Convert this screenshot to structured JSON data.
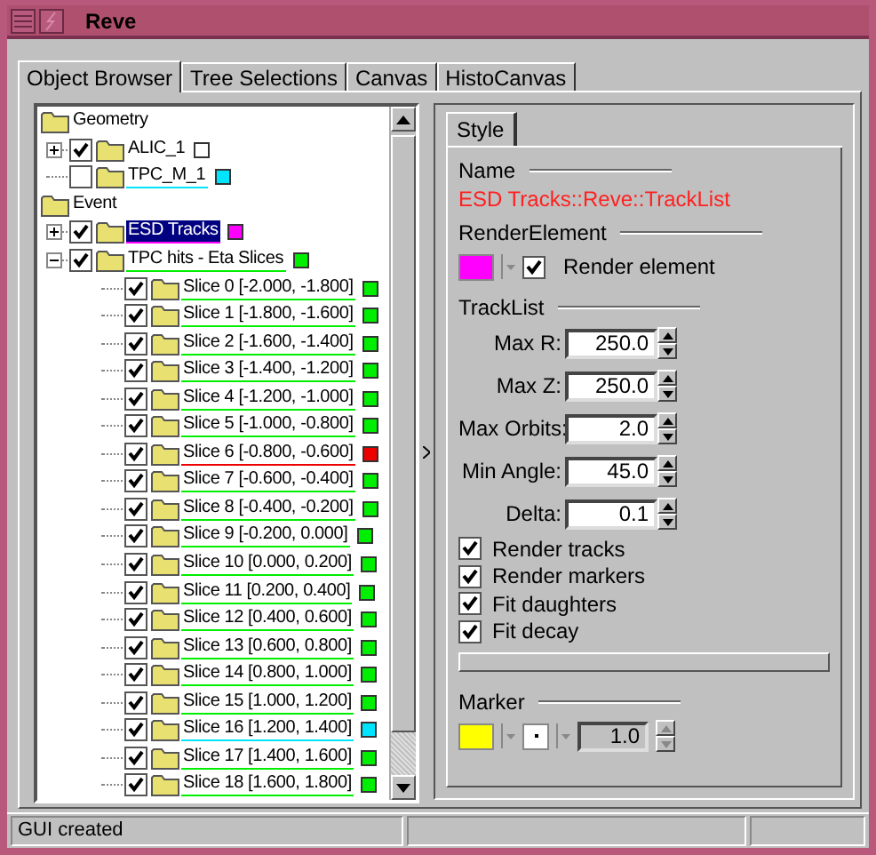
{
  "window": {
    "title": "Reve"
  },
  "tabs": [
    {
      "label": "Object Browser",
      "selected": true
    },
    {
      "label": "Tree Selections",
      "selected": false
    },
    {
      "label": "Canvas",
      "selected": false
    },
    {
      "label": "HistoCanvas",
      "selected": false
    }
  ],
  "tree": [
    {
      "label": "Geometry",
      "kind": "folder",
      "selected": false,
      "children": [
        {
          "label": "ALIC_1",
          "kind": "element",
          "checked": true,
          "expanded": false,
          "selected": false,
          "color": "#ffffff"
        },
        {
          "label": "TPC_M_1",
          "kind": "element",
          "checked": false,
          "selected": false,
          "color": "#00e5ff"
        }
      ]
    },
    {
      "label": "Event",
      "kind": "folder",
      "selected": false,
      "children": [
        {
          "label": "ESD Tracks",
          "kind": "element",
          "checked": true,
          "expanded": false,
          "selected": true,
          "color": "#ff00ff"
        },
        {
          "label": "TPC hits - Eta Slices",
          "kind": "element",
          "checked": true,
          "expanded": true,
          "selected": false,
          "color": "#00ee00",
          "children": [
            {
              "label": "Slice 0 [-2.000, -1.800]",
              "kind": "element",
              "checked": true,
              "selected": false,
              "color": "#00ee00"
            },
            {
              "label": "Slice 1 [-1.800, -1.600]",
              "kind": "element",
              "checked": true,
              "selected": false,
              "color": "#00ee00"
            },
            {
              "label": "Slice 2 [-1.600, -1.400]",
              "kind": "element",
              "checked": true,
              "selected": false,
              "color": "#00ee00"
            },
            {
              "label": "Slice 3 [-1.400, -1.200]",
              "kind": "element",
              "checked": true,
              "selected": false,
              "color": "#00ee00"
            },
            {
              "label": "Slice 4 [-1.200, -1.000]",
              "kind": "element",
              "checked": true,
              "selected": false,
              "color": "#00ee00"
            },
            {
              "label": "Slice 5 [-1.000, -0.800]",
              "kind": "element",
              "checked": true,
              "selected": false,
              "color": "#00ee00"
            },
            {
              "label": "Slice 6 [-0.800, -0.600]",
              "kind": "element",
              "checked": true,
              "selected": false,
              "color": "#ee0000"
            },
            {
              "label": "Slice 7 [-0.600, -0.400]",
              "kind": "element",
              "checked": true,
              "selected": false,
              "color": "#00ee00"
            },
            {
              "label": "Slice 8 [-0.400, -0.200]",
              "kind": "element",
              "checked": true,
              "selected": false,
              "color": "#00ee00"
            },
            {
              "label": "Slice 9 [-0.200, 0.000]",
              "kind": "element",
              "checked": true,
              "selected": false,
              "color": "#00ee00"
            },
            {
              "label": "Slice 10 [0.000, 0.200]",
              "kind": "element",
              "checked": true,
              "selected": false,
              "color": "#00ee00"
            },
            {
              "label": "Slice 11 [0.200, 0.400]",
              "kind": "element",
              "checked": true,
              "selected": false,
              "color": "#00ee00"
            },
            {
              "label": "Slice 12 [0.400, 0.600]",
              "kind": "element",
              "checked": true,
              "selected": false,
              "color": "#00ee00"
            },
            {
              "label": "Slice 13 [0.600, 0.800]",
              "kind": "element",
              "checked": true,
              "selected": false,
              "color": "#00ee00"
            },
            {
              "label": "Slice 14 [0.800, 1.000]",
              "kind": "element",
              "checked": true,
              "selected": false,
              "color": "#00ee00"
            },
            {
              "label": "Slice 15 [1.000, 1.200]",
              "kind": "element",
              "checked": true,
              "selected": false,
              "color": "#00ee00"
            },
            {
              "label": "Slice 16 [1.200, 1.400]",
              "kind": "element",
              "checked": true,
              "selected": false,
              "color": "#00e5ff"
            },
            {
              "label": "Slice 17 [1.400, 1.600]",
              "kind": "element",
              "checked": true,
              "selected": false,
              "color": "#00ee00"
            },
            {
              "label": "Slice 18 [1.600, 1.800]",
              "kind": "element",
              "checked": true,
              "selected": false,
              "color": "#00ee00"
            }
          ]
        }
      ]
    }
  ],
  "editor": {
    "tab": {
      "label": "Style"
    },
    "name_section": {
      "label": "Name",
      "value": "ESD Tracks::Reve::TrackList"
    },
    "render_section": {
      "label": "RenderElement",
      "color": "#ff00ff",
      "checkbox": {
        "label": "Render element",
        "checked": true
      }
    },
    "tracklist": {
      "label": "TrackList",
      "fields": [
        {
          "label": "Max R:",
          "value": "250.0"
        },
        {
          "label": "Max Z:",
          "value": "250.0"
        },
        {
          "label": "Max Orbits:",
          "value": "2.0"
        },
        {
          "label": "Min Angle:",
          "value": "45.0"
        },
        {
          "label": "Delta:",
          "value": "0.1"
        }
      ],
      "options": [
        {
          "label": "Render tracks",
          "checked": true
        },
        {
          "label": "Render markers",
          "checked": true
        },
        {
          "label": "Fit daughters",
          "checked": true
        },
        {
          "label": "Fit decay",
          "checked": true
        }
      ]
    },
    "marker": {
      "label": "Marker",
      "color": "#ffff00",
      "size": "1.0"
    }
  },
  "status_bar": {
    "text": "GUI created"
  }
}
